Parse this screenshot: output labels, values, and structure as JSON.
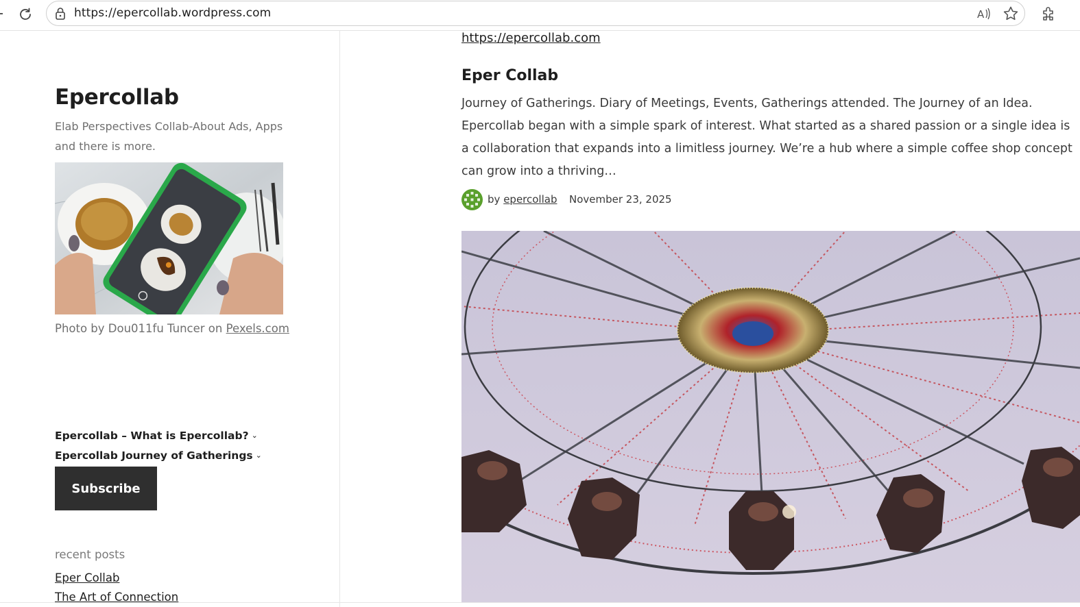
{
  "browser": {
    "url": "https://epercollab.wordpress.com",
    "icons": [
      "reload-icon",
      "lock-icon",
      "read-aloud-icon",
      "favorite-star-icon",
      "extensions-icon"
    ]
  },
  "sidebar": {
    "site_title": "Epercollab",
    "site_description": "Elab Perspectives Collab-About Ads, Apps and there is more.",
    "photo_caption_prefix": "Photo by Dou011fu Tuncer on ",
    "photo_caption_link": "Pexels.com",
    "nav": [
      {
        "label": "Epercollab – What is Epercollab?"
      },
      {
        "label": "Epercollab Journey of Gatherings"
      }
    ],
    "subscribe_label": "Subscribe",
    "recent_heading": "recent posts",
    "recent_posts": [
      "Eper Collab",
      "The Art of Connection"
    ]
  },
  "post": {
    "top_link": "https://epercollab.com",
    "title": "Eper Collab",
    "excerpt": "Journey of Gatherings. Diary of Meetings, Events, Gatherings attended. The Journey of an Idea. Epercollab began with a simple spark of interest. What started as a shared passion or a single idea is a collaboration that expands into a limitless journey. We’re a hub where a simple coffee shop concept can grow into a thriving…",
    "by_prefix": "by",
    "author": "epercollab",
    "date": "November 23, 2025"
  },
  "colors": {
    "text": "#1e1e1e",
    "muted": "#6f6f6f",
    "button": "#2f2f2f",
    "avatar": "#5aa02c"
  }
}
